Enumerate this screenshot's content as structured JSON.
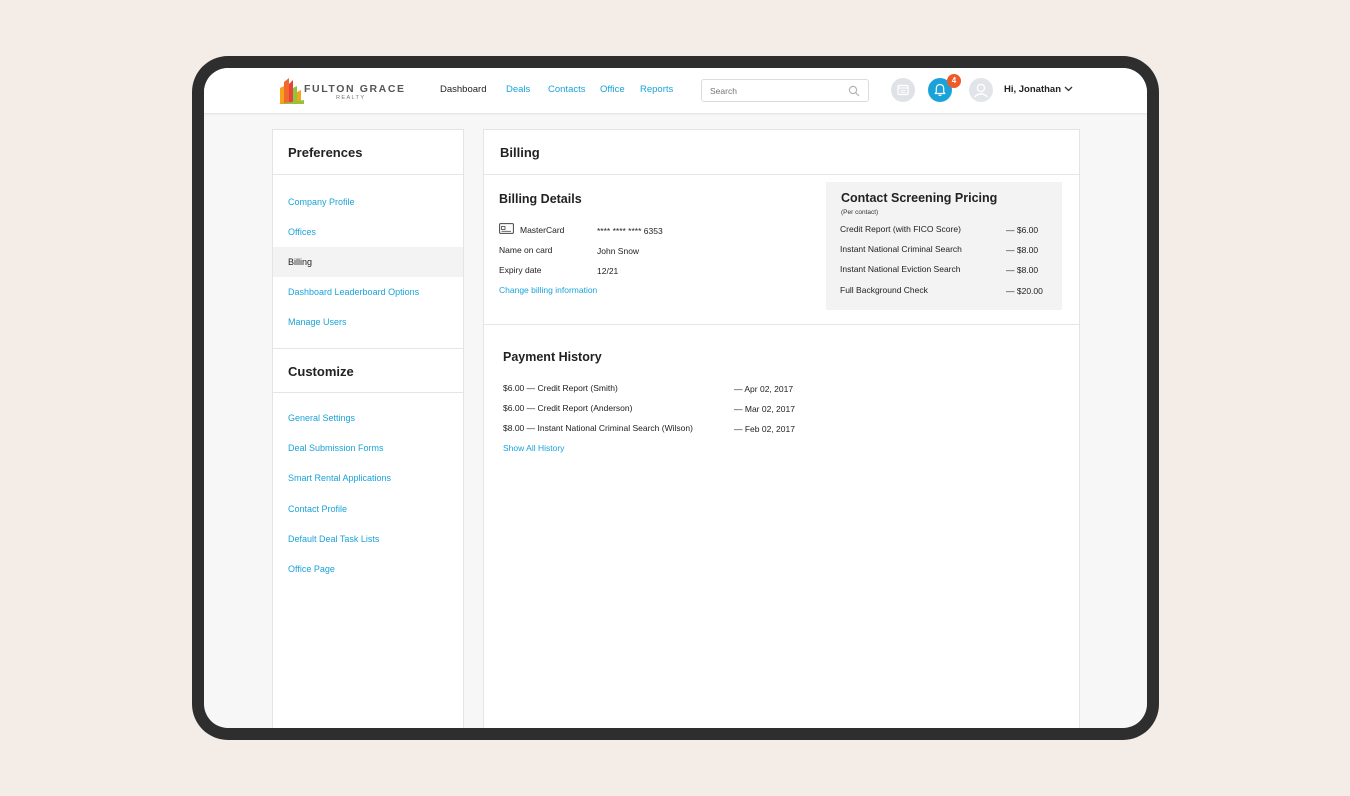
{
  "brand": {
    "name_line1": "FULTON GRACE",
    "name_line2": "REALTY"
  },
  "nav": {
    "items": [
      {
        "label": "Dashboard",
        "active": true
      },
      {
        "label": "Deals",
        "active": false
      },
      {
        "label": "Contacts",
        "active": false
      },
      {
        "label": "Office",
        "active": false
      },
      {
        "label": "Reports",
        "active": false
      }
    ]
  },
  "search": {
    "placeholder": "Search"
  },
  "notifications": {
    "count": "4"
  },
  "user": {
    "greeting": "Hi, Jonathan"
  },
  "colors": {
    "accent": "#1aa3d9",
    "badge": "#f05a28",
    "page_bg": "#f4ece6",
    "device": "#2e2e2e"
  },
  "sidebar": {
    "preferences_title": "Preferences",
    "preferences_items": [
      {
        "label": "Company Profile",
        "active": false
      },
      {
        "label": "Offices",
        "active": false
      },
      {
        "label": "Billing",
        "active": true
      },
      {
        "label": "Dashboard Leaderboard Options",
        "active": false
      },
      {
        "label": "Manage Users",
        "active": false
      }
    ],
    "customize_title": "Customize",
    "customize_items": [
      {
        "label": "General Settings"
      },
      {
        "label": "Deal Submission Forms"
      },
      {
        "label": "Smart Rental Applications"
      },
      {
        "label": "Contact Profile"
      },
      {
        "label": "Default Deal Task Lists"
      },
      {
        "label": "Office Page"
      }
    ]
  },
  "billing": {
    "title": "Billing",
    "details_title": "Billing Details",
    "card_type": "MasterCard",
    "card_number": "**** **** **** 6353",
    "name_label": "Name on card",
    "name_value": "John Snow",
    "expiry_label": "Expiry date",
    "expiry_value": "12/21",
    "change_link": "Change billing information"
  },
  "pricing": {
    "title": "Contact Screening Pricing",
    "subtitle": "(Per contact)",
    "items": [
      {
        "label": "Credit Report (with FICO Score)",
        "price": "— $6.00"
      },
      {
        "label": "Instant National Criminal Search",
        "price": "— $8.00"
      },
      {
        "label": "Instant National Eviction Search",
        "price": "— $8.00"
      },
      {
        "label": "Full Background Check",
        "price": "— $20.00"
      }
    ]
  },
  "payment_history": {
    "title": "Payment History",
    "items": [
      {
        "desc": "$6.00 — Credit Report (Smith)",
        "date": "— Apr 02, 2017"
      },
      {
        "desc": "$6.00 — Credit Report (Anderson)",
        "date": "— Mar 02, 2017"
      },
      {
        "desc": "$8.00 — Instant National Criminal Search (Wilson)",
        "date": "— Feb 02, 2017"
      }
    ],
    "show_all": "Show All History"
  }
}
